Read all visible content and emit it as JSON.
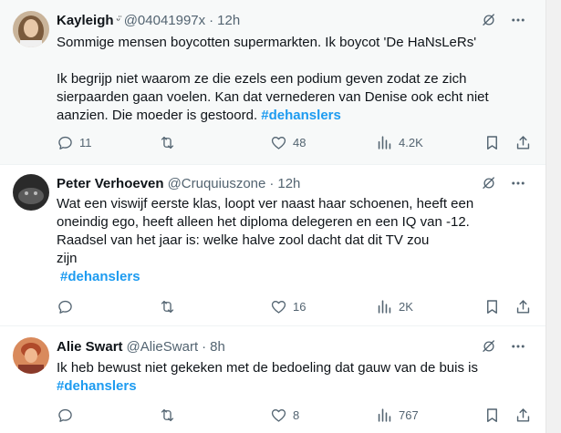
{
  "tweets": [
    {
      "name": "Kayleigh",
      "emoji": "ᵕ̈",
      "handle": "@04041997x",
      "time": "12h",
      "lines": [
        "Sommige mensen boycotten supermarkten. Ik boycot 'De HaNsLeRs'",
        "Ik begrijp niet waarom ze die ezels een podium geven zodat ze zich",
        "sierpaarden gaan voelen. Kan dat vernederen van Denise ook echt niet",
        "aanzien. Die moeder is gestoord. "
      ],
      "hashtag": "#dehanslers",
      "replies": "11",
      "retweets": "",
      "likes": "48",
      "views": "4.2K",
      "avatar_colors": {
        "bg": "#c9b49a",
        "hair": "#7a5a3c",
        "face": "#e8c8a8"
      }
    },
    {
      "name": "Peter Verhoeven",
      "handle": "@Cruquiuszone",
      "time": "12h",
      "lines": [
        "Wat een viswijf eerste klas, loopt ver naast haar schoenen, heeft een",
        "oneindig ego, heeft alleen het diploma delegeren en een IQ van -12.",
        "Raadsel van het jaar is: welke halve zool dacht dat dit TV zou",
        "zijn"
      ],
      "hashtag": "#dehanslers",
      "replies": "",
      "retweets": "",
      "likes": "16",
      "views": "2K",
      "avatar_colors": {
        "bg": "#2a2a2a",
        "fur": "#5a5a5a"
      }
    },
    {
      "name": "Alie Swart",
      "handle": "@AlieSwart",
      "time": "8h",
      "lines": [
        "Ik heb bewust niet gekeken met de bedoeling dat gauw van de buis is"
      ],
      "hashtag": "#dehanslers",
      "replies": "",
      "retweets": "",
      "likes": "8",
      "views": "767",
      "avatar_colors": {
        "bg": "#d98a5c",
        "hair": "#b04a2a",
        "face": "#f0b890"
      }
    }
  ],
  "colors": {
    "accent": "#1d9bf0",
    "muted": "#536471",
    "text": "#0f1419"
  },
  "icons": [
    "grok-icon",
    "more-icon",
    "reply-icon",
    "retweet-icon",
    "like-icon",
    "views-icon",
    "bookmark-icon",
    "share-icon"
  ]
}
